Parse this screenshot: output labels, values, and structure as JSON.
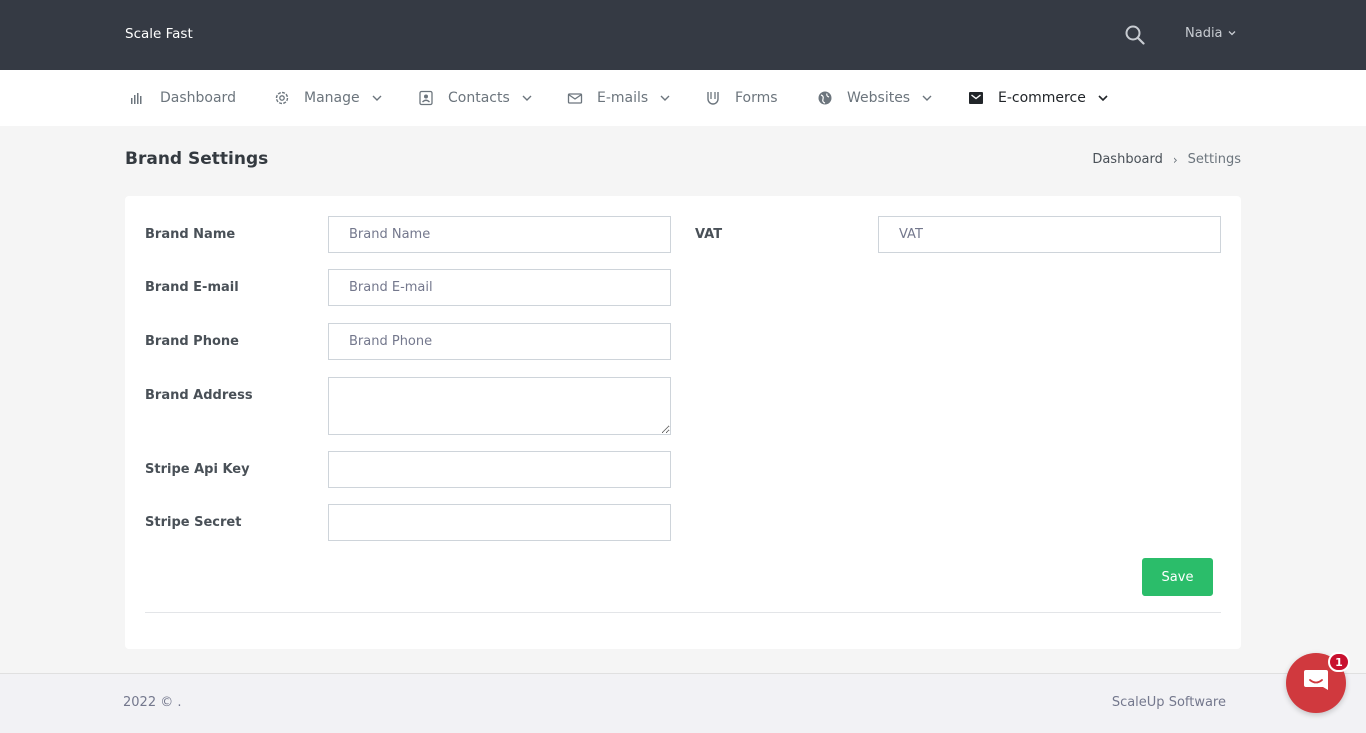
{
  "app": {
    "brand": "Scale Fast"
  },
  "header": {
    "user_name": "Nadia"
  },
  "nav": {
    "items": [
      {
        "label": "Dashboard",
        "icon": "bar-chart-icon",
        "has_dropdown": false
      },
      {
        "label": "Manage",
        "icon": "gear-icon",
        "has_dropdown": true
      },
      {
        "label": "Contacts",
        "icon": "contact-card-icon",
        "has_dropdown": true
      },
      {
        "label": "E-mails",
        "icon": "envelope-open-icon",
        "has_dropdown": true
      },
      {
        "label": "Forms",
        "icon": "magnet-icon",
        "has_dropdown": false
      },
      {
        "label": "Websites",
        "icon": "globe-icon",
        "has_dropdown": true
      },
      {
        "label": "E-commerce",
        "icon": "envelope-filled-icon",
        "has_dropdown": true
      }
    ],
    "active": "E-commerce"
  },
  "page": {
    "title": "Brand Settings",
    "breadcrumb": {
      "parent": "Dashboard",
      "separator": "›",
      "current": "Settings"
    }
  },
  "form": {
    "brand_name": {
      "label": "Brand Name",
      "placeholder": "Brand Name",
      "value": ""
    },
    "brand_email": {
      "label": "Brand E-mail",
      "placeholder": "Brand E-mail",
      "value": ""
    },
    "brand_phone": {
      "label": "Brand Phone",
      "placeholder": "Brand Phone",
      "value": ""
    },
    "brand_address": {
      "label": "Brand Address",
      "placeholder": "",
      "value": ""
    },
    "stripe_api_key": {
      "label": "Stripe Api Key",
      "placeholder": "",
      "value": ""
    },
    "stripe_secret": {
      "label": "Stripe Secret",
      "placeholder": "",
      "value": ""
    },
    "vat": {
      "label": "VAT",
      "placeholder": "VAT",
      "value": ""
    },
    "save_label": "Save"
  },
  "footer": {
    "left": "2022 © .",
    "right": "ScaleUp Software"
  },
  "chat": {
    "badge_count": "1"
  },
  "colors": {
    "topbar": "#353a44",
    "accent_green": "#2bbd6a",
    "chat_red": "#d0393e"
  }
}
